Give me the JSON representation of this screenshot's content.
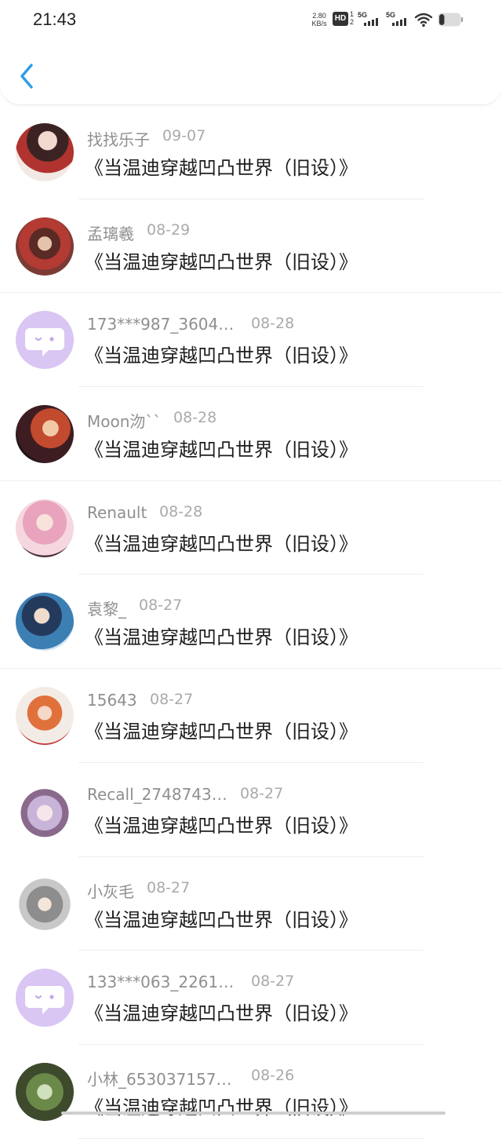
{
  "status_bar": {
    "time": "21:43",
    "net_speed_value": "2.80",
    "net_speed_unit": "KB/s",
    "hd_label": "HD",
    "hd_sub_top": "1",
    "hd_sub_bottom": "2",
    "signal1_label": "5G",
    "signal2_label": "5G",
    "battery_level": 0.25
  },
  "header": {
    "back_icon": "chevron-left-icon",
    "accent_color": "#2f9be8"
  },
  "comments": [
    {
      "user": "找找乐子",
      "date": "09-07",
      "text": "《当温迪穿越凹凸世界（旧设）》",
      "avatar": "avatar-1"
    },
    {
      "user": "孟璃羲",
      "date": "08-29",
      "text": "《当温迪穿越凹凸世界（旧设）》",
      "avatar": "avatar-2"
    },
    {
      "user": "173***987_3604…",
      "date": "08-28",
      "text": "《当温迪穿越凹凸世界（旧设）》",
      "avatar": "default"
    },
    {
      "user": "Moon沕``",
      "date": "08-28",
      "text": "《当温迪穿越凹凸世界（旧设）》",
      "avatar": "avatar-4"
    },
    {
      "user": "Renault",
      "date": "08-28",
      "text": "《当温迪穿越凹凸世界（旧设）》",
      "avatar": "avatar-5"
    },
    {
      "user": "袁黎_",
      "date": "08-27",
      "text": "《当温迪穿越凹凸世界（旧设）》",
      "avatar": "avatar-6"
    },
    {
      "user": "15643",
      "date": "08-27",
      "text": "《当温迪穿越凹凸世界（旧设）》",
      "avatar": "avatar-7"
    },
    {
      "user": "Recall_2748743…",
      "date": "08-27",
      "text": "《当温迪穿越凹凸世界（旧设）》",
      "avatar": "avatar-8"
    },
    {
      "user": "小灰毛",
      "date": "08-27",
      "text": "《当温迪穿越凹凸世界（旧设）》",
      "avatar": "avatar-9"
    },
    {
      "user": "133***063_2261…",
      "date": "08-27",
      "text": "《当温迪穿越凹凸世界（旧设）》",
      "avatar": "default"
    },
    {
      "user": "小林_653037157…",
      "date": "08-26",
      "text": "《当温迪穿越凹凸世界（旧设）》",
      "avatar": "avatar-11"
    }
  ],
  "colors": {
    "default_avatar_bg": "#d9c6f3",
    "username": "#8f8f8f",
    "date": "#aaaaaa",
    "text": "#1e1e1e"
  }
}
